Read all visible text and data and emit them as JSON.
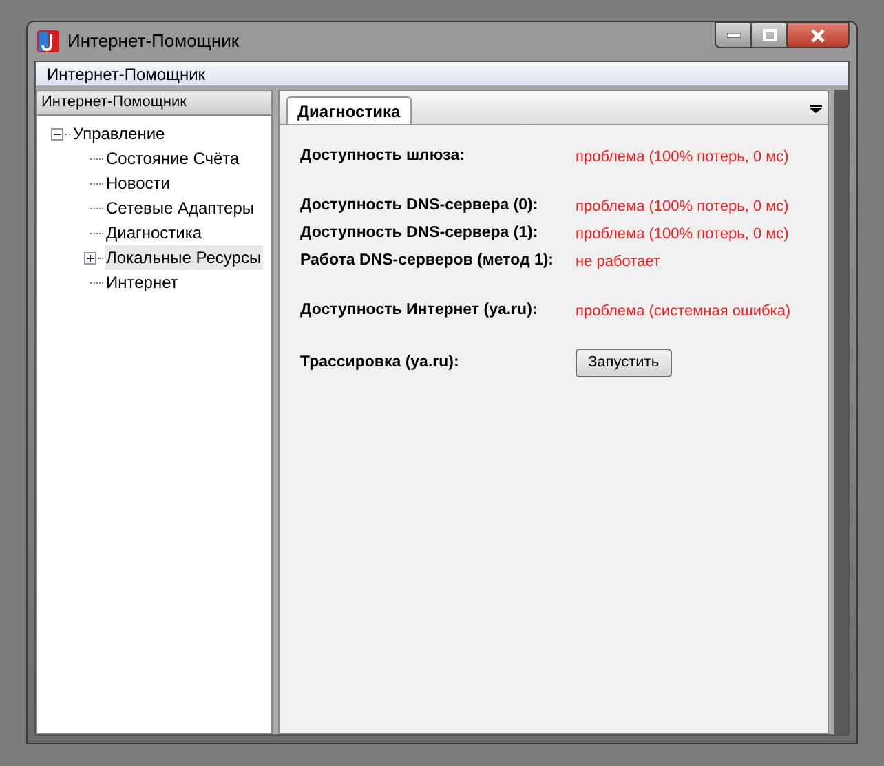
{
  "window": {
    "title": "Интернет-Помощник"
  },
  "menu_bar": {
    "label": "Интернет-Помощник"
  },
  "sidebar": {
    "title": "Интернет-Помощник",
    "items": [
      {
        "label": "Управление",
        "expanded": true,
        "selected": false,
        "children": [
          {
            "label": "Состояние Счёта",
            "selected": false
          },
          {
            "label": "Новости",
            "selected": false
          },
          {
            "label": "Сетевые Адаптеры",
            "selected": false
          },
          {
            "label": "Диагностика",
            "selected": false
          },
          {
            "label": "Локальные Ресурсы",
            "expanded": false,
            "selected": true
          },
          {
            "label": "Интернет",
            "selected": false
          }
        ]
      }
    ]
  },
  "tabs": [
    {
      "label": "Диагностика",
      "selected": true
    }
  ],
  "groups": [
    [
      {
        "kind": "status",
        "label": "Доступность шлюза:",
        "value": "проблема (100% потерь, 0 мс)"
      }
    ],
    [
      {
        "kind": "status",
        "label": "Доступность DNS-сервера (0):",
        "value": "проблема (100% потерь, 0 мс)"
      },
      {
        "kind": "status",
        "label": "Доступность DNS-сервера (1):",
        "value": "проблема (100% потерь, 0 мс)"
      },
      {
        "kind": "status",
        "label": "Работа DNS-серверов (метод 1):",
        "value": "не работает"
      }
    ],
    [
      {
        "kind": "status",
        "label": "Доступность Интернет (ya.ru):",
        "value": "проблема (системная ошибка)"
      }
    ],
    [
      {
        "kind": "button",
        "label": "Трассировка (ya.ru):",
        "button": "Запустить"
      }
    ]
  ]
}
